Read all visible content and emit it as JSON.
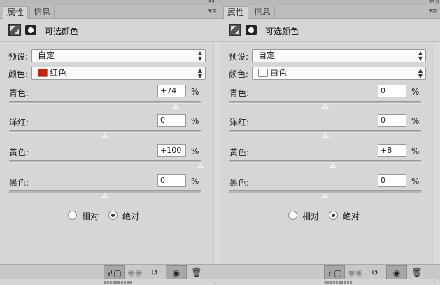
{
  "panels": [
    {
      "tabs": [
        {
          "label": "属性"
        },
        {
          "label": "信息"
        }
      ],
      "title": "可选颜色",
      "preset": {
        "label": "预设:",
        "value": "自定"
      },
      "colors": {
        "label": "颜色:",
        "value": "红色",
        "swatch": "#cc2200"
      },
      "sliders": [
        {
          "label": "青色:",
          "value": "+74",
          "unit": "%",
          "position": 87
        },
        {
          "label": "洋红:",
          "value": "0",
          "unit": "%",
          "position": 50
        },
        {
          "label": "黄色:",
          "value": "+100",
          "unit": "%",
          "position": 100
        },
        {
          "label": "黑色:",
          "value": "0",
          "unit": "%",
          "position": 50
        }
      ],
      "method": {
        "relative": "相对",
        "absolute": "绝对",
        "selected": "absolute"
      }
    },
    {
      "tabs": [
        {
          "label": "属性"
        },
        {
          "label": "信息"
        }
      ],
      "title": "可选颜色",
      "preset": {
        "label": "预设:",
        "value": "自定"
      },
      "colors": {
        "label": "颜色:",
        "value": "白色",
        "swatch": "#ffffff"
      },
      "sliders": [
        {
          "label": "青色:",
          "value": "0",
          "unit": "%",
          "position": 50
        },
        {
          "label": "洋红:",
          "value": "0",
          "unit": "%",
          "position": 50
        },
        {
          "label": "黄色:",
          "value": "+8",
          "unit": "%",
          "position": 54
        },
        {
          "label": "黑色:",
          "value": "0",
          "unit": "%",
          "position": 50
        }
      ],
      "method": {
        "relative": "相对",
        "absolute": "绝对",
        "selected": "absolute"
      }
    }
  ],
  "footer": {
    "icons": [
      "clip-to-layer-icon",
      "view-previous-icon",
      "reset-icon",
      "visibility-eye-icon",
      "trash-icon"
    ]
  }
}
